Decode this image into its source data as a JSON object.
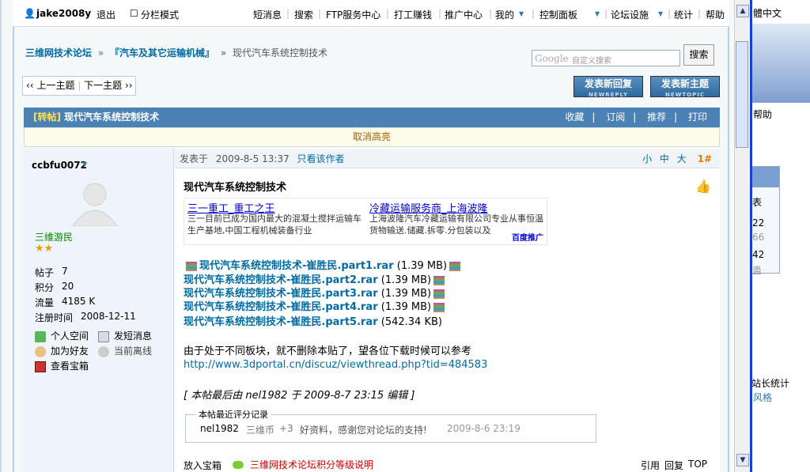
{
  "topbar": {
    "user": "jake2008y",
    "logout": "退出",
    "split": "分栏模式",
    "links": [
      "短消息",
      "搜索",
      "FTP服务中心",
      "打工赚钱",
      "推广中心",
      "我的",
      "控制面板",
      "论坛设施",
      "统计",
      "帮助"
    ]
  },
  "breadcrumb": {
    "home": "三维网技术论坛",
    "sep1": "»",
    "forum": "『汽车及其它运输机械』",
    "sep2": "»",
    "current": "现代汽车系统控制技术"
  },
  "search": {
    "placeholder": "自定义搜索",
    "google": "Google",
    "button": "搜索"
  },
  "pager": {
    "prev": "上一主题",
    "next": "下一主题"
  },
  "buttons": {
    "reply": "发表新回复",
    "reply_sub": "NEWREPLY",
    "newtopic": "发表新主题",
    "newtopic_sub": "NEWTOPIC"
  },
  "thread": {
    "tag": "[转帖]",
    "title": "现代汽车系统控制技术",
    "actions": [
      "收藏",
      "订阅",
      "推荐",
      "打印"
    ],
    "cancel_highlight": "取消高亮"
  },
  "author": {
    "name": "ccbfu0072",
    "rank": "三维游民",
    "posts_label": "帖子",
    "posts": "7",
    "points_label": "积分",
    "points": "20",
    "traffic_label": "流量",
    "traffic": "4185 K",
    "reg_label": "注册时间",
    "reg": "2008-12-11",
    "space": "个人空间",
    "msg": "发短消息",
    "friend": "加为好友",
    "status": "当前离线",
    "treasure": "查看宝箱"
  },
  "post": {
    "posted": "发表于",
    "time": "2009-8-5 13:37",
    "only_author": "只看该作者",
    "font_sizes": [
      "小",
      "中",
      "大"
    ],
    "floor": "1#",
    "title": "现代汽车系统控制技术",
    "ads": [
      {
        "title": "三一重工_重工之王",
        "desc": "三一目前已成为国内最大的混凝土搅拌运输车生产基地,中国工程机械装备行业"
      },
      {
        "title": "冷藏运输服务商_上海波隆",
        "desc": "上海波隆汽车冷藏运输有限公司专业从事恒温货物输送.储藏.拆零.分包装以及"
      }
    ],
    "ad_brand": "百度推广",
    "files": [
      {
        "name": "现代汽车系统控制技术-崔胜民.part1.rar",
        "size": "(1.39 MB)"
      },
      {
        "name": "现代汽车系统控制技术-崔胜民.part2.rar",
        "size": "(1.39 MB)"
      },
      {
        "name": "现代汽车系统控制技术-崔胜民.part3.rar",
        "size": "(1.39 MB)"
      },
      {
        "name": "现代汽车系统控制技术-崔胜民.part4.rar",
        "size": "(1.39 MB)"
      },
      {
        "name": "现代汽车系统控制技术-崔胜民.part5.rar",
        "size": "(542.34 KB)"
      }
    ],
    "body": "由于处于不同板块，就不删除本贴了，望各位下载时候可以参考",
    "url": "http://www.3dportal.cn/discuz/viewthread.php?tid=484583",
    "edited": "[ 本帖最后由  nel1982  于  2009-8-7 23:15  编辑  ]",
    "rating_legend": "本帖最近评分记录",
    "rating": {
      "user": "nel1982",
      "item": "三维币",
      "score": "+3",
      "comment": "好资料，感谢您对论坛的支持!",
      "time": "2009-8-6 23:19"
    },
    "footer_left": "放入宝箱",
    "footer_link": "三维网技术论坛积分等级说明",
    "footer_right": [
      "引用",
      "回复",
      "TOP"
    ]
  },
  "sidepanel": {
    "lines": [
      "體中文",
      "帮助",
      "表",
      "22",
      "66",
      "42",
      "蛊",
      "站长统计",
      "风格"
    ]
  }
}
